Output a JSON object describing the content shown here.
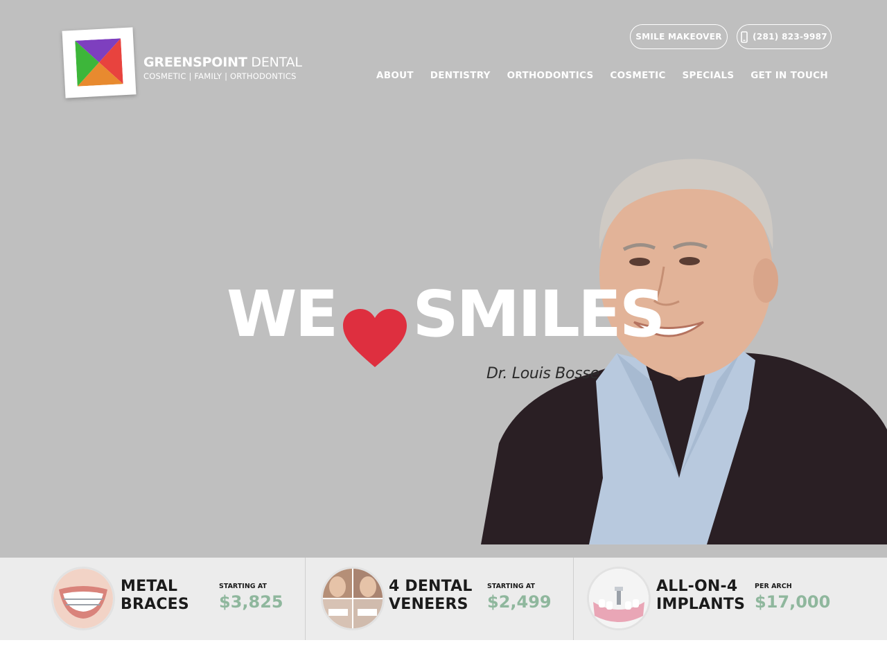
{
  "brand": {
    "name_bold": "GREENSPOINT",
    "name_light": "DENTAL",
    "tagline": "COSMETIC | FAMILY | ORTHODONTICS",
    "logo_colors": [
      "#7e3fbf",
      "#e8433e",
      "#e88a2f",
      "#3db63a"
    ]
  },
  "header": {
    "smile_makeover_label": "SMILE MAKEOVER",
    "phone_label": "(281) 823-9987",
    "phone_icon": "mobile-phone-icon"
  },
  "nav": {
    "items": [
      {
        "label": "ABOUT"
      },
      {
        "label": "DENTISTRY"
      },
      {
        "label": "ORTHODONTICS"
      },
      {
        "label": "COSMETIC"
      },
      {
        "label": "SPECIALS"
      },
      {
        "label": "GET IN TOUCH"
      }
    ]
  },
  "hero": {
    "headline_left": "WE",
    "headline_right": "SMILES",
    "heart_icon": "heart-icon",
    "heart_color": "#de2f3f",
    "doctor_name": "Dr. Louis Bosse",
    "background_color": "#bfbfbf"
  },
  "specials": [
    {
      "title_line1": "METAL",
      "title_line2": "BRACES",
      "price_label": "STARTING AT",
      "price": "$3,825",
      "image": "braces-smile-photo"
    },
    {
      "title_line1": "4 DENTAL",
      "title_line2": "VENEERS",
      "price_label": "STARTING AT",
      "price": "$2,499",
      "image": "veneers-before-after-photo"
    },
    {
      "title_line1": "ALL-ON-4",
      "title_line2": "IMPLANTS",
      "price_label": "PER ARCH",
      "price": "$17,000",
      "image": "dental-implant-model-photo"
    }
  ],
  "colors": {
    "price_green": "#8fb79d",
    "strip_bg": "#ececec"
  }
}
